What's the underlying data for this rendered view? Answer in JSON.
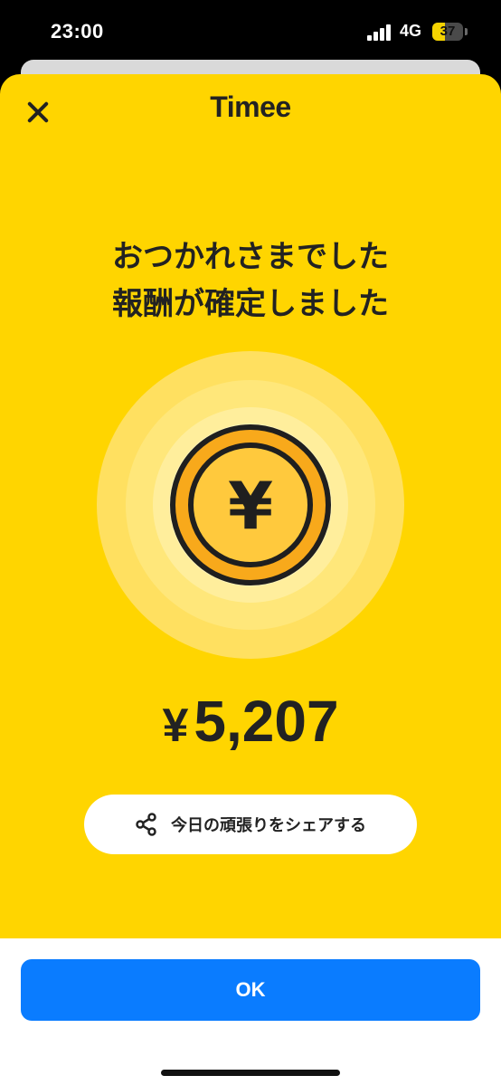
{
  "status_bar": {
    "time": "23:00",
    "network": "4G",
    "battery": "37"
  },
  "header": {
    "logo": "Timee",
    "close_icon": "close-icon"
  },
  "main": {
    "headline_line1": "おつかれさまでした",
    "headline_line2": "報酬が確定しました",
    "coin_icon": "yen-coin-icon",
    "amount_symbol": "¥",
    "amount_value": "5,207",
    "share_label": "今日の頑張りをシェアする",
    "share_icon": "share-icon"
  },
  "footer": {
    "ok_label": "OK"
  },
  "colors": {
    "brand_yellow": "#FFD500",
    "primary_blue": "#0A7CFF",
    "text_dark": "#222222"
  }
}
